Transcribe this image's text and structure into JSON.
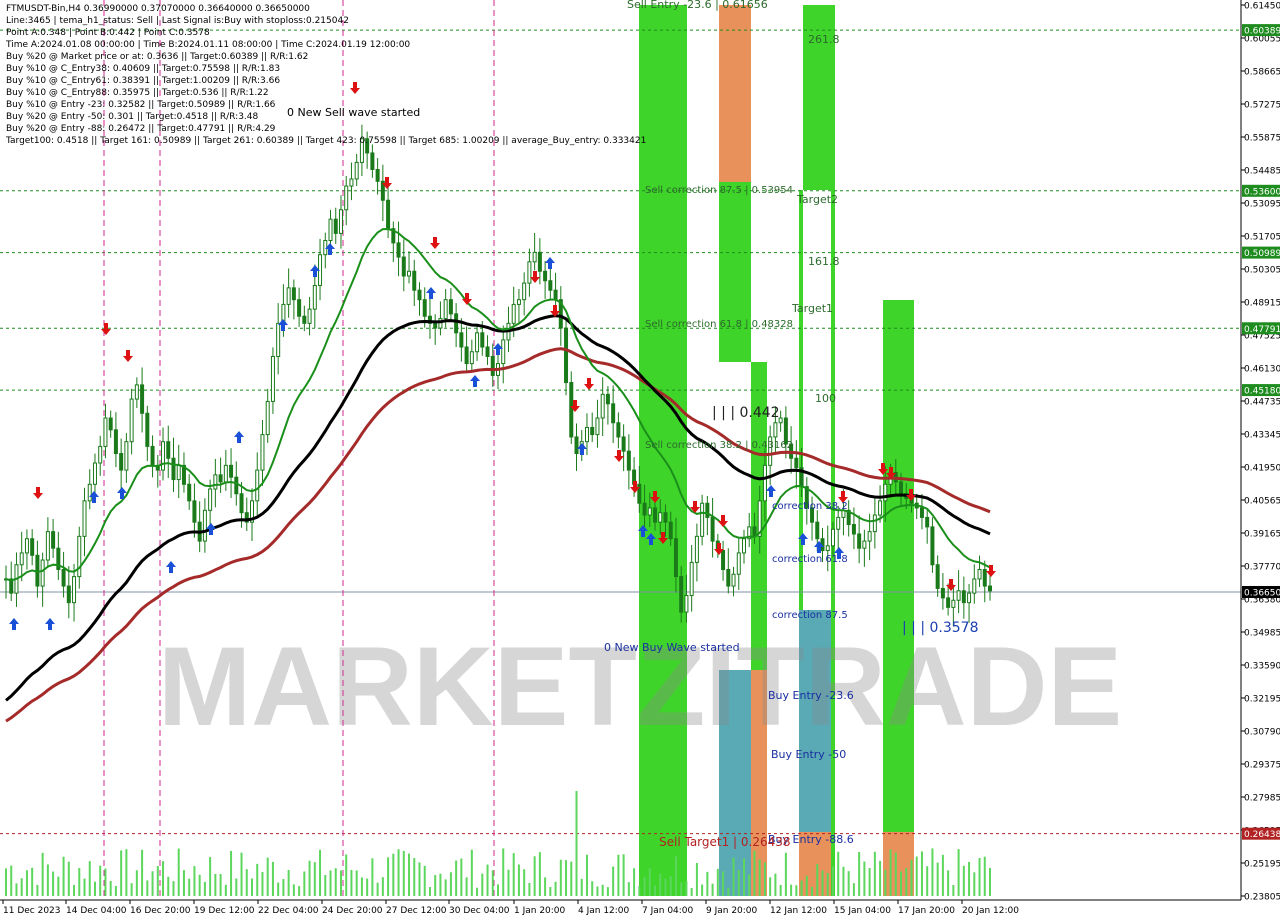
{
  "window": {
    "symbol_line": "FTMUSDT-Bin,H4  0.36990000 0.37070000 0.36640000 0.36650000"
  },
  "info_lines": [
    "Line:3465 | tema_h1_status: Sell | Last Signal is:Buy with stoploss:0.215042",
    "Point A:0.348 | Point B:0.442 | Point C:0.3578",
    "Time A:2024.01.08 00:00:00 | Time B:2024.01.11 08:00:00 | Time C:2024.01.19 12:00:00",
    "Buy %20 @ Market price or at: 0.3636 || Target:0.60389 || R/R:1.62",
    "Buy %10 @ C_Entry38: 0.40609 || Target:0.75598 || R/R:1.83",
    "Buy %10 @ C_Entry61: 0.38391 || Target:1.00209 || R/R:3.66",
    "Buy %10 @ C_Entry88: 0.35975 || Target:0.536 || R/R:1.22",
    "Buy %10 @ Entry -23: 0.32582 || Target:0.50989 || R/R:1.66",
    "Buy %20 @ Entry -50: 0.301 || Target:0.4518 || R/R:3.48",
    "Buy %20 @ Entry -88: 0.26472 || Target:0.47791 || R/R:4.29",
    "Target100: 0.4518 || Target 161: 0.50989 || Target 261: 0.60389 || Target 423: 0.75598 || Target 685: 1.00209 || average_Buy_entry: 0.333421"
  ],
  "price_axis": {
    "ticks": [
      "0.61450",
      "0.60055",
      "0.58665",
      "0.57275",
      "0.55875",
      "0.54485",
      "0.53095",
      "0.51705",
      "0.50305",
      "0.48915",
      "0.47525",
      "0.46130",
      "0.44735",
      "0.43345",
      "0.41950",
      "0.40565",
      "0.39165",
      "0.37770",
      "0.36380",
      "0.34985",
      "0.33590",
      "0.32195",
      "0.30790",
      "0.29375",
      "0.27985",
      "0.26595",
      "0.25195",
      "0.23805"
    ],
    "level_tags": [
      {
        "label": "0.60389",
        "price": 0.60389,
        "color": "#1e8c1e"
      },
      {
        "label": "0.53600",
        "price": 0.536,
        "color": "#1e8c1e"
      },
      {
        "label": "0.50989",
        "price": 0.50989,
        "color": "#1e8c1e"
      },
      {
        "label": "0.47791",
        "price": 0.47791,
        "color": "#1e8c1e"
      },
      {
        "label": "0.45180",
        "price": 0.4518,
        "color": "#1e8c1e"
      },
      {
        "label": "0.26438",
        "price": 0.26438,
        "color": "#b22222"
      }
    ],
    "current_price": {
      "label": "0.36650",
      "price": 0.3665
    }
  },
  "time_axis": {
    "ticks": [
      "11 Dec 2023",
      "14 Dec 04:00",
      "16 Dec 20:00",
      "19 Dec 12:00",
      "22 Dec 04:00",
      "24 Dec 20:00",
      "27 Dec 12:00",
      "30 Dec 04:00",
      "1 Jan 20:00",
      "4 Jan 12:00",
      "7 Jan 04:00",
      "9 Jan 20:00",
      "12 Jan 12:00",
      "15 Jan 04:00",
      "17 Jan 20:00",
      "20 Jan 12:00"
    ]
  },
  "annotations": {
    "sell_entry": "Sell Entry -23.6 | 0.61656",
    "new_sell_wave": "0 New Sell wave started",
    "new_buy_wave": "0 New Buy Wave started",
    "sell_corr_875": "Sell correction 87.5 | 0.53954",
    "sell_corr_618": "Sell correction 61.8 | 0.48328",
    "sell_corr_382": "Sell correction 38.2 | 0.43162",
    "point_b": "| | | 0.442",
    "point_c": "| | | 0.3578",
    "fib_2618": "261.8",
    "fib_1618": "161.8",
    "fib_100": "100",
    "target2": "Target2",
    "target1": "Target1",
    "corr_382": "correction 38.2",
    "corr_618": "correction 61.8",
    "corr_875": "correction 87.5",
    "buy_entry_236": "Buy Entry -23.6",
    "buy_entry_50": "Buy Entry -50",
    "buy_entry_886": "Buy Entry -88.6",
    "sell_target1": "Sell Target1 | 0.26438"
  },
  "watermark": "MARKETZITRADE",
  "colors": {
    "ema_fast": "#1a8f1a",
    "ema_mid": "#000000",
    "ema_slow": "#a52a2a",
    "candle": "#1a7a1a",
    "buy_arrow": "#1a4fd8",
    "sell_arrow": "#dd1111",
    "zone_green": "#3fd42a",
    "zone_orange": "#e8915a",
    "zone_teal": "#5aaab5",
    "grid_green": "#1e8c1e",
    "grid_red": "#b22222",
    "grid_magenta": "#d02a8e"
  },
  "price_series_close": [
    0.372,
    0.366,
    0.378,
    0.383,
    0.389,
    0.382,
    0.369,
    0.38,
    0.392,
    0.385,
    0.376,
    0.369,
    0.362,
    0.373,
    0.39,
    0.405,
    0.412,
    0.421,
    0.428,
    0.44,
    0.435,
    0.425,
    0.418,
    0.43,
    0.448,
    0.454,
    0.442,
    0.428,
    0.42,
    0.418,
    0.43,
    0.423,
    0.414,
    0.42,
    0.412,
    0.405,
    0.396,
    0.388,
    0.401,
    0.41,
    0.416,
    0.413,
    0.42,
    0.415,
    0.408,
    0.4,
    0.396,
    0.405,
    0.418,
    0.433,
    0.447,
    0.466,
    0.48,
    0.488,
    0.495,
    0.49,
    0.483,
    0.48,
    0.486,
    0.496,
    0.509,
    0.515,
    0.524,
    0.518,
    0.528,
    0.538,
    0.541,
    0.548,
    0.558,
    0.552,
    0.545,
    0.54,
    0.532,
    0.52,
    0.514,
    0.508,
    0.5,
    0.502,
    0.494,
    0.49,
    0.483,
    0.48,
    0.478,
    0.482,
    0.49,
    0.484,
    0.476,
    0.47,
    0.463,
    0.468,
    0.476,
    0.47,
    0.466,
    0.458,
    0.463,
    0.473,
    0.48,
    0.488,
    0.49,
    0.497,
    0.506,
    0.51,
    0.502,
    0.498,
    0.494,
    0.49,
    0.478,
    0.455,
    0.432,
    0.425,
    0.43,
    0.436,
    0.433,
    0.44,
    0.45,
    0.446,
    0.438,
    0.432,
    0.426,
    0.418,
    0.412,
    0.404,
    0.399,
    0.402,
    0.396,
    0.4,
    0.396,
    0.389,
    0.373,
    0.358,
    0.365,
    0.379,
    0.39,
    0.404,
    0.398,
    0.388,
    0.384,
    0.376,
    0.369,
    0.374,
    0.383,
    0.389,
    0.394,
    0.39,
    0.405,
    0.42,
    0.432,
    0.438,
    0.44,
    0.429,
    0.423,
    0.419,
    0.411,
    0.402,
    0.396,
    0.389,
    0.384,
    0.386,
    0.393,
    0.398,
    0.401,
    0.395,
    0.391,
    0.385,
    0.388,
    0.392,
    0.399,
    0.405,
    0.412,
    0.417,
    0.413,
    0.408,
    0.406,
    0.404,
    0.402,
    0.398,
    0.394,
    0.378,
    0.368,
    0.364,
    0.36,
    0.363,
    0.367,
    0.362,
    0.366,
    0.372,
    0.376,
    0.369,
    0.367
  ]
}
